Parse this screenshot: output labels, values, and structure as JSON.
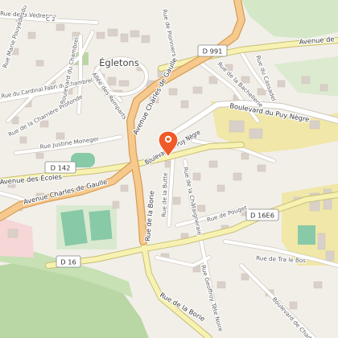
{
  "map": {
    "town": "Égletons",
    "road_shields": {
      "d991": "D 991",
      "d142": "D 142",
      "d16e6": "D 16E6",
      "d16": "D 16"
    },
    "streets": {
      "avenue_charles_de_gaulle_north": "Avenue Charles de Gaulle",
      "avenue_charles_de_gaulle_west": "Avenue Charles de Gaulle",
      "avenue_de_right": "Avenue de",
      "avenue_des_ecoles": "Avenue des Écoles",
      "boulevard_du_puy_negre": "Boulevard du Puy Nègre",
      "boulevard_du_puy_negre_short": "Boulevard du Puy Nègre",
      "rue_de_la_borie_west": "Rue de la Borie",
      "rue_de_la_borie_south": "Rue de la Borie",
      "rue_de_la_vedrenne": "Rue de la Vedrenne",
      "c2": "C 2",
      "rue_marie_pouyadesdu": "Rue Marie Pouyadesdu",
      "rue_du_cardinal": "Rue du Cardinal Fabri du Chambrel",
      "boulevard_du_chambrel": "Boulevard du Chambrel",
      "allee_des_remparts": "Allée des Remparts",
      "rue_de_la_charriere": "Rue de la Charrière Profonde",
      "rue_justine_moneger": "Rue Justine Moneger",
      "rue_de_la_butte": "Rue de la Butte",
      "rue_de_la_chataignerie": "Rue de la Châtaigneraie",
      "rue_de_pouget": "Rue de Pouget",
      "rue_de_la_bachellerie": "Rue de la Bachellerie",
      "rue_du_cassadel": "Rue du Cassadel",
      "rue_de_tra_le_bos": "Rue de Tra le Bos",
      "rue_geoffroy_tete_noire": "Rue Geoffroy Tête Noire",
      "boulevard_de_chadaux": "Boulevard de Chadaux",
      "pioneers_top": "Rue de Pionniers"
    },
    "colors": {
      "background": "#f2efe9",
      "major_road_fill": "#f6c98e",
      "major_road_casing": "#d99d54",
      "secondary_road_fill": "#f7f2b2",
      "secondary_road_casing": "#c8be74",
      "street_fill": "#ffffff",
      "street_casing": "#cfc8bd",
      "building": "#d9d0c9",
      "park": "#d4e8c8",
      "forest": "#b9d7a5",
      "sports_pitch": "#88c9a8",
      "industrial": "#f0e7a8",
      "commercial": "#f6d6d6",
      "pin": "#f05a28"
    },
    "marker": {
      "icon": "map-pin-icon",
      "label": "location marker"
    }
  }
}
